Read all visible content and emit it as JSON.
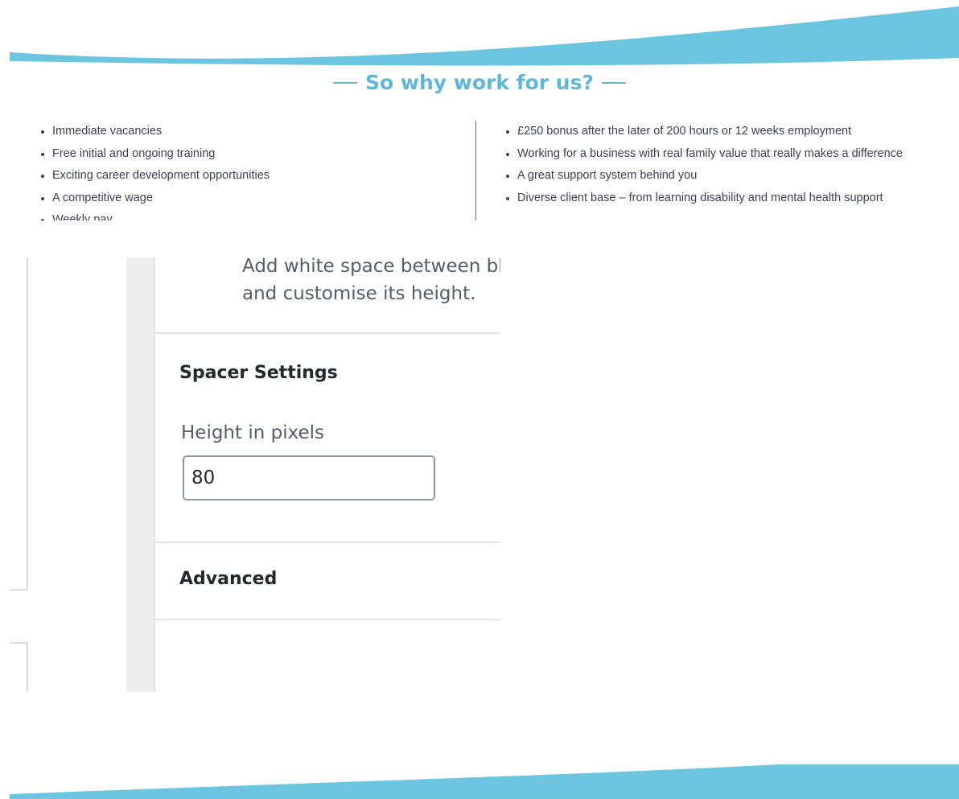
{
  "colors": {
    "accent": "#5fb6d6",
    "wave": "#6bc4e0",
    "bullet_text": "#3a3f52",
    "panel_text": "#555d66",
    "panel_heading": "#23282d"
  },
  "website": {
    "heading": "So why work for us?",
    "left_benefits": [
      "Immediate vacancies",
      "Free initial and ongoing training",
      "Exciting career development opportunities",
      "A competitive wage",
      "Weekly pay"
    ],
    "right_benefits": [
      "£250 bonus after the later of 200 hours or 12 weeks employment",
      "Working for a business with real family value that really makes a difference",
      "A great support system behind you",
      "Diverse client base – from learning disability and mental health support"
    ]
  },
  "editor": {
    "block_description_line1": "Add white space between bl",
    "block_description_line2": "and customise its height.",
    "spacer_settings_title": "Spacer Settings",
    "height_label": "Height in pixels",
    "height_value": "80",
    "advanced_title": "Advanced"
  }
}
